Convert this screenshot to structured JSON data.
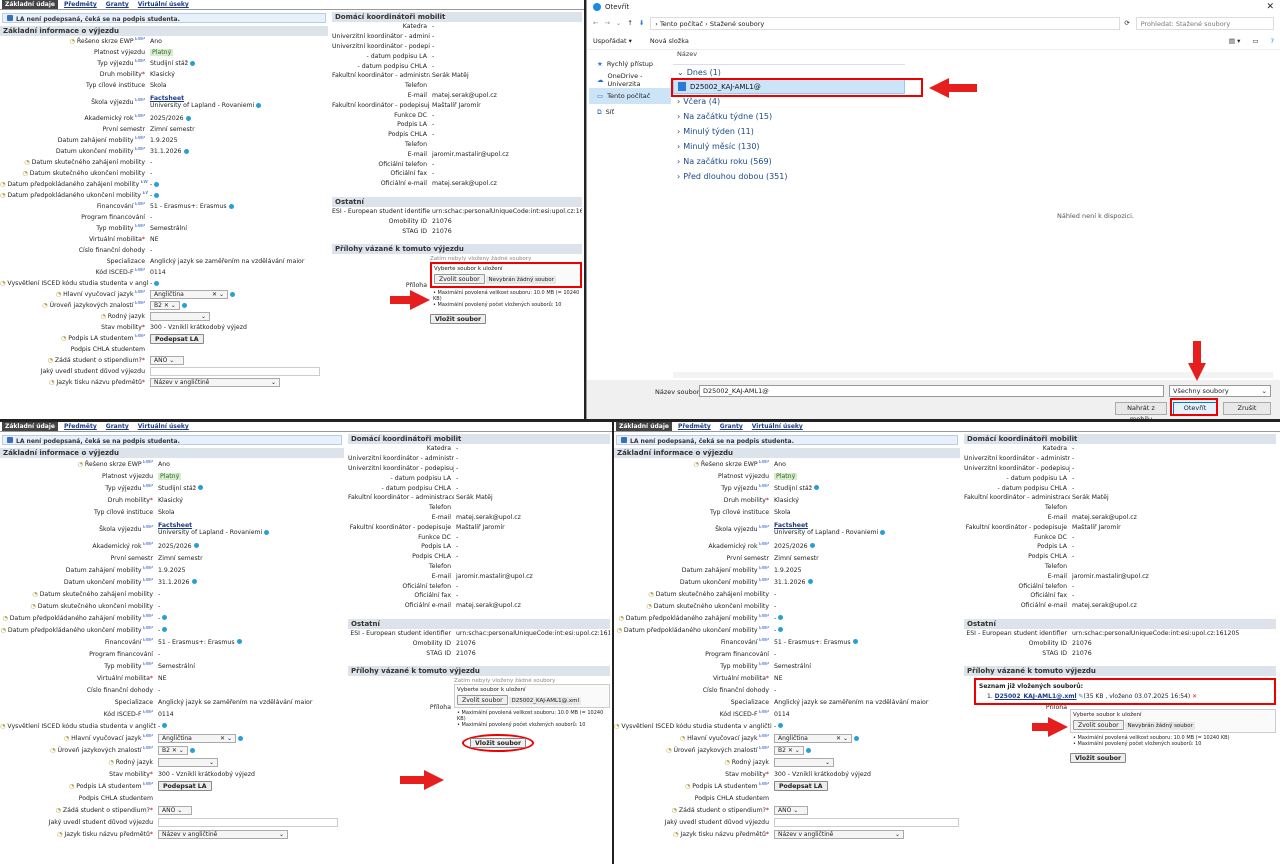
{
  "app": {
    "tabs": [
      "Základní údaje",
      "Předměty",
      "Granty",
      "Virtuální úseky"
    ],
    "notice": "LA není podepsaná, čeká se na podpis studenta.",
    "basic_section": "Základní informace o výjezdu",
    "left_rows": [
      {
        "label": "Řešeno skrze EWP",
        "value": "Ano"
      },
      {
        "label": "Platnost výjezdu",
        "value": "Platný"
      },
      {
        "label": "Typ výjezdu",
        "value": "Studijní stáž"
      },
      {
        "label": "Druh mobility",
        "value": "Klasický"
      },
      {
        "label": "Typ cílové instituce",
        "value": "Škola"
      },
      {
        "label": "Škola výjezdu",
        "value": "University of Lapland - Rovaniemi"
      },
      {
        "label": "Akademický rok",
        "value": "2025/2026"
      },
      {
        "label": "První semestr",
        "value": "Zimní semestr"
      },
      {
        "label": "Datum zahájení mobility",
        "value": "1.9.2025"
      },
      {
        "label": "Datum ukončení mobility",
        "value": "31.1.2026"
      },
      {
        "label": "Datum skutečného zahájení mobility",
        "value": "-"
      },
      {
        "label": "Datum skutečného ukončení mobility",
        "value": "-"
      },
      {
        "label": "Datum předpokládaného zahájení mobility",
        "value": "-"
      },
      {
        "label": "Datum předpokládaného ukončení mobility",
        "value": "-"
      },
      {
        "label": "Financování",
        "value": "51 - Erasmus+: Erasmus"
      },
      {
        "label": "Program financování",
        "value": "-"
      },
      {
        "label": "Typ mobility",
        "value": "Semestrální"
      },
      {
        "label": "Virtuální mobilita",
        "value": "NE"
      },
      {
        "label": "Číslo finanční dohody",
        "value": "-"
      },
      {
        "label": "Specializace",
        "value": "Anglický jazyk se zaměřením na vzdělávání maior"
      },
      {
        "label": "Kód ISCED-F",
        "value": "0114"
      },
      {
        "label": "Vysvětlení ISCED kódu studia studenta v angličtině",
        "value": "-"
      },
      {
        "label": "Hlavní vyučovací jazyk",
        "value": "Angličtina"
      },
      {
        "label": "Úroveň jazykových znalostí",
        "value": "B2"
      },
      {
        "label": "Rodný jazyk",
        "value": ""
      },
      {
        "label": "Stav mobility",
        "value": "300 - Vzniklí krátkodobý výjezd"
      },
      {
        "label": "Podpis LA studentem",
        "value": "Podepsat LA"
      },
      {
        "label": "Podpis CHLA studentem",
        "value": ""
      },
      {
        "label": "Žádá student o stipendium?",
        "value": "ANO"
      },
      {
        "label": "Jaký uvedl student důvod výjezdu",
        "value": ""
      },
      {
        "label": "Jazyk tisku názvu předmětů",
        "value": "Název v angličtině"
      }
    ],
    "factsheet": "Factsheet",
    "domestic_section": "Domácí koordinátoři mobilit",
    "right_rows": [
      {
        "label": "Katedra",
        "value": "-"
      },
      {
        "label": "Univerzitní koordinátor - administrace",
        "value": "-"
      },
      {
        "label": "Univerzitní koordinátor - podepisuje",
        "value": "-"
      },
      {
        "label": "- datum podpisu LA",
        "value": "-"
      },
      {
        "label": "- datum podpisu CHLA",
        "value": "-"
      },
      {
        "label": "Fakultní koordinátor - administrace",
        "value": "Šerák Matěj"
      },
      {
        "label": "Telefon",
        "value": ""
      },
      {
        "label": "E-mail",
        "value": "matej.serak@upol.cz"
      },
      {
        "label": "Fakultní koordinátor - podepisuje",
        "value": "Maštalíř Jaromír"
      },
      {
        "label": "Funkce DC",
        "value": "-"
      },
      {
        "label": "Podpis LA",
        "value": "-"
      },
      {
        "label": "Podpis CHLA",
        "value": "-"
      },
      {
        "label": "Telefon",
        "value": ""
      },
      {
        "label": "E-mail",
        "value": "jaromir.mastalir@upol.cz"
      },
      {
        "label": "Oficiální telefon",
        "value": "-"
      },
      {
        "label": "Oficiální fax",
        "value": "-"
      },
      {
        "label": "Oficiální e-mail",
        "value": "matej.serak@upol.cz"
      }
    ],
    "other_section": "Ostatní",
    "other_rows": [
      {
        "label": "ESI - European student identifier",
        "value": "urn:schac:personalUniqueCode:int:esi:upol.cz:161205"
      },
      {
        "label": "Omobility ID",
        "value": "21076"
      },
      {
        "label": "STAG ID",
        "value": "21076"
      }
    ],
    "attach_section": "Přílohy vázané k tomuto výjezdu",
    "attach_label": "Příloha",
    "no_files": "Zatím nebyly vloženy žádné soubory",
    "choose_caption": "Vyberte soubor k uložení",
    "choose_btn": "Zvolit soubor",
    "no_file_chosen": "Nevybrán žádný soubor",
    "chosen_file": "D25002_KAJ-AML1@.xml",
    "limit1": "Maximální povolená velikost souboru: 10.0 MB (= 10240 KB)",
    "limit2": "Maximální povolený počet vložených souborů: 10",
    "insert_btn": "Vložit soubor",
    "uploaded_title": "Seznam již vložených souborů:",
    "uploaded_file": "D25002_KAJ-AML1@.xml",
    "uploaded_meta": "(35 KB , vloženo 03.07.2025 16:54)"
  },
  "dialog": {
    "title": "Otevřít",
    "path": [
      "Tento počítač",
      "Stažené soubory"
    ],
    "search_placeholder": "Prohledat: Stažené soubory",
    "organize": "Uspořádat",
    "new_folder": "Nová složka",
    "nav": [
      "Rychlý přístup",
      "OneDrive - Univerzita",
      "Tento počítač",
      "Síť"
    ],
    "column": "Název",
    "groups": [
      "Dnes (1)",
      "Včera (4)",
      "Na začátku týdne (15)",
      "Minulý týden (11)",
      "Minulý měsíc (130)",
      "Na začátku roku (569)",
      "Před dlouhou dobou (351)"
    ],
    "file": "D25002_KAJ-AML1@",
    "preview": "Náhled není k dispozici.",
    "filename_label": "Název souboru:",
    "filename_value": "D25002_KAJ-AML1@",
    "filter": "Všechny soubory",
    "upload_mobile": "Nahrát z mobilu",
    "open_btn": "Otevřít",
    "cancel_btn": "Zrušit"
  }
}
